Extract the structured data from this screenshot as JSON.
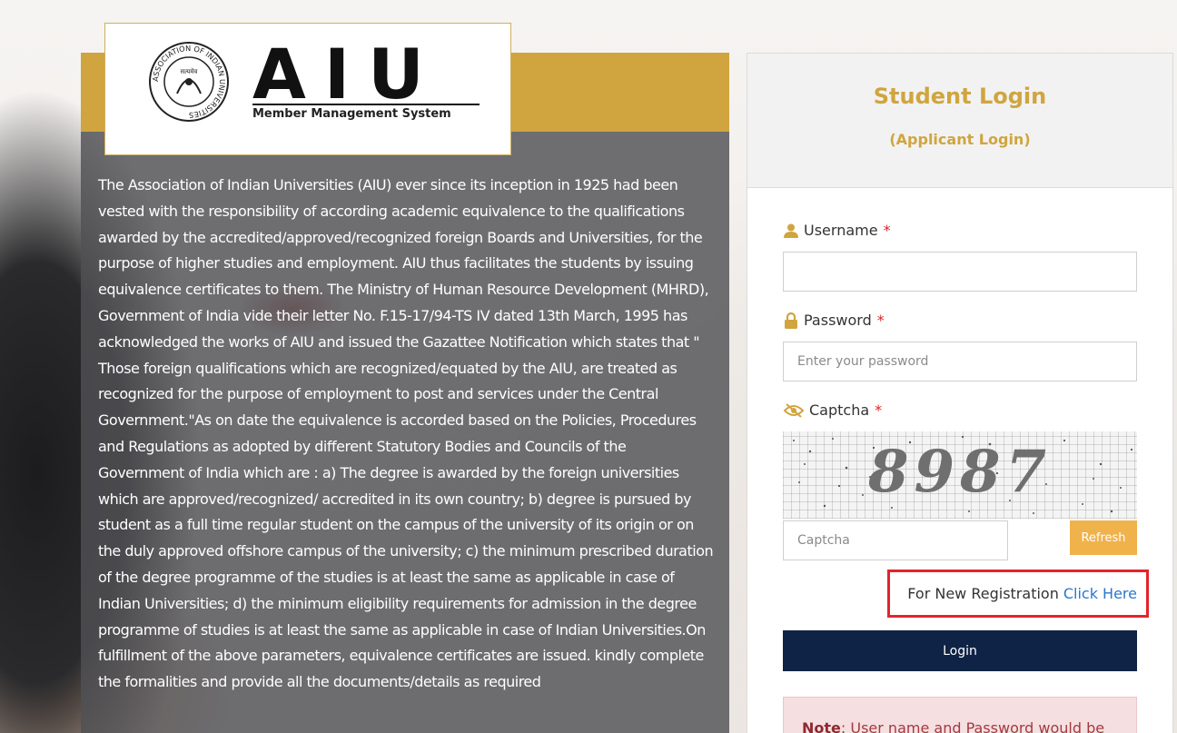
{
  "logo": {
    "seal_text": "ASSOCIATION OF INDIAN UNIVERSITIES",
    "seal_inner": "सत्यमेव",
    "wordmark": "AIU",
    "subtitle": "Member Management System"
  },
  "about": {
    "text": "The Association of Indian Universities (AIU) ever since its inception in 1925 had been vested with the responsibility of according academic equivalence to the qualifications awarded by the accredited/approved/recognized foreign Boards and Universities, for the purpose of higher studies and employment. AIU thus facilitates the students by issuing equivalence certificates to them. The Ministry of Human Resource Development (MHRD), Government of India vide their letter No. F.15-17/94-TS IV dated 13th March, 1995 has acknowledged the works of AIU and issued the Gazattee Notification which states that \" Those foreign qualifications which are recognized/equated by the AIU, are treated as recognized for the purpose of employment to post and services under the Central Government.\"As on date the equivalence is accorded based on the Policies, Procedures and Regulations as adopted by different Statutory Bodies and Councils of the Government of India which are : a) The degree is awarded by the foreign universities which are approved/recognized/ accredited in its own country; b) degree is pursued by student as a full time regular student on the campus of the university of its origin or on the duly approved offshore campus of the university; c) the minimum prescribed duration of the degree programme of the studies is at least the same as applicable in case of Indian Universities; d) the minimum eligibility requirements for admission in the degree programme of studies is at least the same as applicable in case of Indian Universities.On fulfillment of the above parameters, equivalence certificates are issued. kindly complete the formalities and provide all the documents/details as required"
  },
  "login": {
    "title": "Student Login",
    "subtitle": "(Applicant Login)",
    "username": {
      "label": "Username",
      "required_mark": "*",
      "value": "",
      "placeholder": ""
    },
    "password": {
      "label": "Password",
      "required_mark": "*",
      "value": "",
      "placeholder": "Enter your password"
    },
    "captcha": {
      "label": "Captcha",
      "required_mark": "*",
      "code": "8987",
      "input_placeholder": "Captcha",
      "refresh_label": "Refresh"
    },
    "registration": {
      "prefix": "For New Registration",
      "link_label": "Click Here"
    },
    "login_button": "Login",
    "note": {
      "label": "Note",
      "text": ": User name and Password would be"
    }
  },
  "colors": {
    "gold": "#d0a53f",
    "navy": "#0e2345",
    "refresh": "#f0b24b",
    "highlight_red": "#e3242b",
    "link_blue": "#2a77c9"
  },
  "icons": {
    "username": "user-icon",
    "password": "lock-icon",
    "captcha": "eye-slash-icon"
  }
}
